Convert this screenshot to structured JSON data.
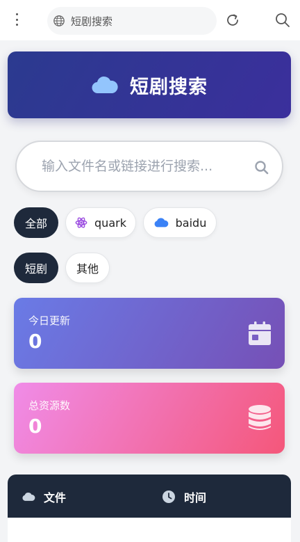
{
  "browser": {
    "url_text": "短剧搜索"
  },
  "banner": {
    "title": "短剧搜索"
  },
  "search": {
    "placeholder": "输入文件名或链接进行搜索..."
  },
  "sources": [
    {
      "label": "全部",
      "active": true
    },
    {
      "label": "quark",
      "icon": "atom-icon",
      "active": false
    },
    {
      "label": "baidu",
      "icon": "cloud-icon",
      "active": false
    }
  ],
  "categories": [
    {
      "label": "短剧",
      "active": true
    },
    {
      "label": "其他",
      "active": false
    }
  ],
  "stats": {
    "today": {
      "label": "今日更新",
      "value": "0",
      "icon": "calendar-icon"
    },
    "total": {
      "label": "总资源数",
      "value": "0",
      "icon": "database-icon"
    }
  },
  "table": {
    "columns": [
      {
        "label": "文件",
        "icon": "cloud-icon"
      },
      {
        "label": "时间",
        "icon": "clock-icon"
      }
    ]
  },
  "colors": {
    "banner": "#2b3a8f",
    "dark_chip": "#1e293b",
    "quark": "#9b4de0",
    "baidu": "#3b82f6"
  }
}
